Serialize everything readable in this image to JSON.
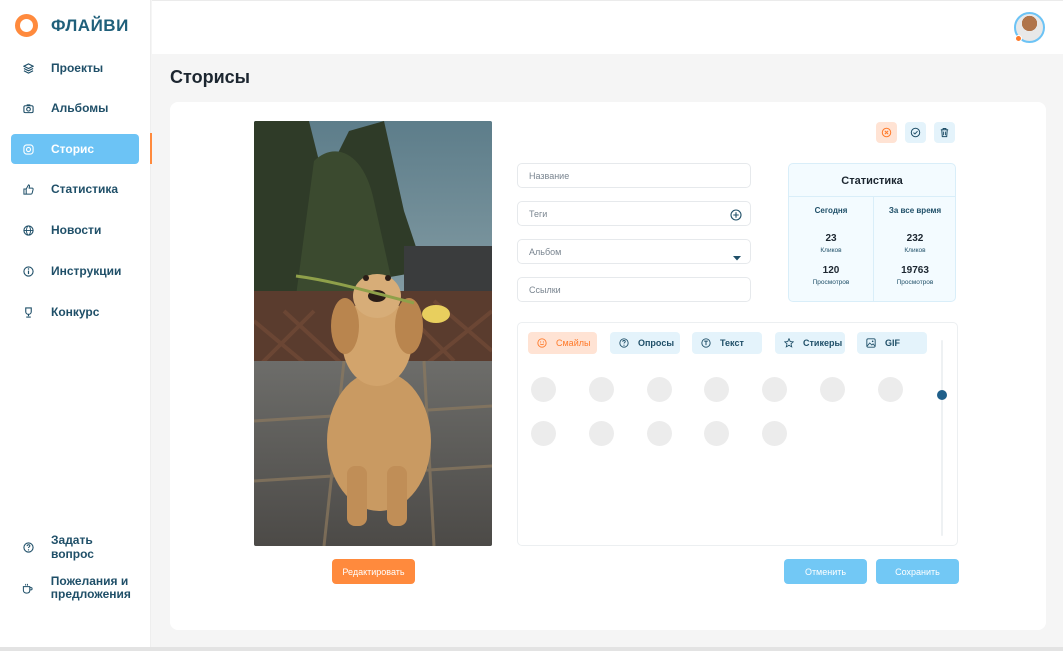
{
  "brand": {
    "name": "ФЛАЙВИ"
  },
  "sidebar": {
    "items": [
      {
        "label": "Проекты",
        "icon": "layers-icon",
        "active": false
      },
      {
        "label": "Альбомы",
        "icon": "camera-icon",
        "active": false
      },
      {
        "label": "Сторис",
        "icon": "instagram-icon",
        "active": true
      },
      {
        "label": "Статистика",
        "icon": "thumbs-up-icon",
        "active": false
      },
      {
        "label": "Новости",
        "icon": "globe-icon",
        "active": false
      },
      {
        "label": "Инструкции",
        "icon": "info-icon",
        "active": false
      },
      {
        "label": "Конкурс",
        "icon": "trophy-icon",
        "active": false
      }
    ],
    "bottom": [
      {
        "label": "Задать вопрос",
        "icon": "question-icon"
      },
      {
        "label": "Пожелания и предложения",
        "icon": "cup-icon"
      }
    ]
  },
  "page": {
    "title": "Сторисы"
  },
  "story": {
    "edit_label": "Редактировать",
    "fields": {
      "name_placeholder": "Название",
      "tags_placeholder": "Теги",
      "album_placeholder": "Альбом",
      "links_placeholder": "Ссылки"
    }
  },
  "stats": {
    "title": "Статистика",
    "today_label": "Сегодня",
    "alltime_label": "За все время",
    "today_clicks": "23",
    "alltime_clicks": "232",
    "clicks_label": "Кликов",
    "today_views": "120",
    "alltime_views": "19763",
    "views_label": "Просмотров"
  },
  "tabs": [
    {
      "label": "Смайлы",
      "icon": "smile-icon",
      "active": true
    },
    {
      "label": "Опросы",
      "icon": "question-circle-icon",
      "active": false
    },
    {
      "label": "Текст",
      "icon": "text-icon",
      "active": false
    },
    {
      "label": "Стикеры",
      "icon": "star-icon",
      "active": false
    },
    {
      "label": "GIF",
      "icon": "image-icon",
      "active": false
    }
  ],
  "actions": {
    "cancel_label": "Отменить",
    "save_label": "Сохранить"
  },
  "colors": {
    "accent": "#ff8a3d",
    "primary": "#6cc3f5",
    "brand_text": "#1f5f7a"
  }
}
